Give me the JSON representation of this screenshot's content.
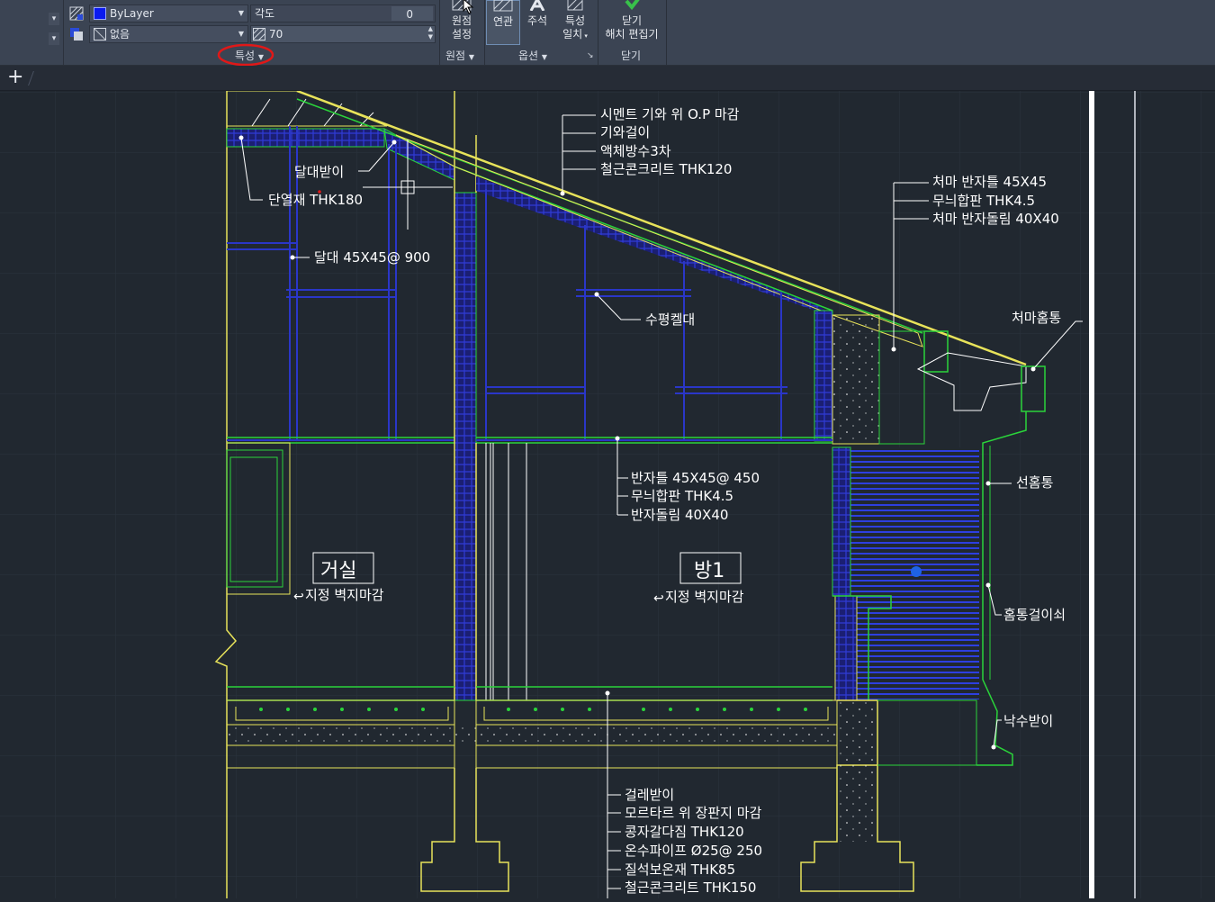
{
  "properties": {
    "color_value": "ByLayer",
    "bgcolor_value": "없음",
    "angle_label": "각도",
    "angle_value": "0",
    "transparency_value": "70",
    "panel_label": "특성"
  },
  "origin_panel": {
    "set_origin_label_1": "원점",
    "set_origin_label_2": "설정",
    "panel_label": "원점"
  },
  "options_panel": {
    "associative_label": "연관",
    "annotative_label": "주석",
    "match_props_label_1": "특성",
    "match_props_label_2": "일치",
    "panel_label": "옵션"
  },
  "close_panel": {
    "close_label_1": "닫기",
    "close_label_2": "해치 편집기",
    "panel_label": "닫기"
  },
  "tabs": {
    "new_tab": "+"
  },
  "drawing": {
    "roof_notes": [
      "시멘트 기와 위 O.P 마감",
      "기와걸이",
      "액체방수3차",
      "철근콘크리트 THK120"
    ],
    "eave_notes": [
      "처마 반자틀 45X45",
      "무늬합판 THK4.5",
      "처마 반자돌림 40X40"
    ],
    "furring": "달대받이",
    "insulation": "단열재 THK180",
    "hanger": "달대 45X45@ 900",
    "horizontal_member": "수평켈대",
    "gutter": "처마홈통",
    "ceiling_notes": [
      "반자틀 45X45@ 450",
      "무늬합판 THK4.5",
      "반자돌림 40X40"
    ],
    "downspout": "선홈통",
    "gutter_hanger": "홈통걸이쇠",
    "splash_block": "낙수받이",
    "room_living": "거실",
    "room_living_note": "지정 벽지마감",
    "room_1": "방1",
    "room_1_note": "지정 벽지마감",
    "floor_notes": [
      "걸레받이",
      "모르타르 위 장판지 마감",
      "콩자갈다짐 THK120",
      "온수파이프 Ø25@ 250",
      "질석보온재 THK85",
      "철근콘크리트 THK150"
    ]
  },
  "colors": {
    "ribbon_bg": "#3b4453",
    "canvas_bg": "#212830",
    "annotation": "#ffffff",
    "wall_yellow": "#e8e35a",
    "hatch_blue": "#2233cc",
    "frame_green": "#2ad43a",
    "highlight_red": "#e01818"
  }
}
